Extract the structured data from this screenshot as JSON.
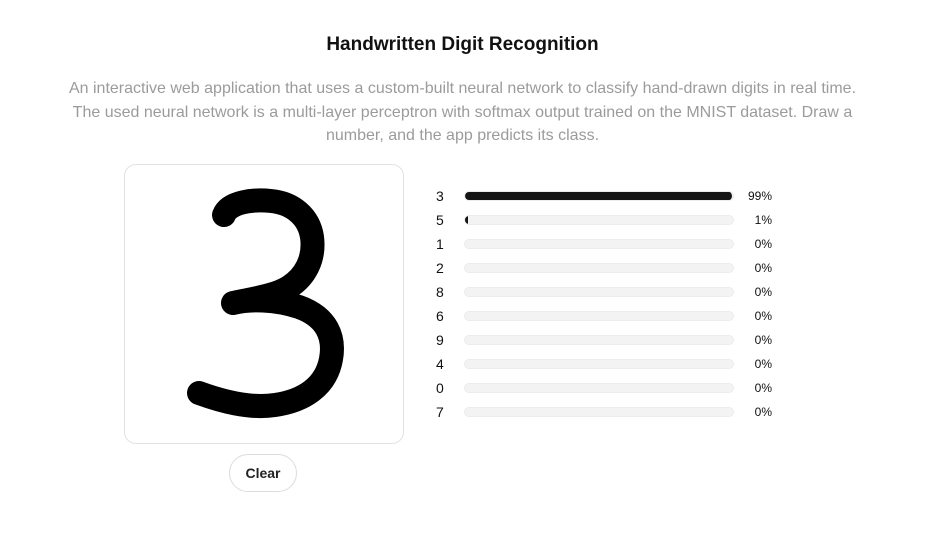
{
  "header": {
    "title": "Handwritten Digit Recognition",
    "description": "An interactive web application that uses a custom-built neural network to classify hand-drawn digits in real time. The used neural network is a multi-layer perceptron with softmax output trained on the MNIST dataset. Draw a number, and the app predicts its class."
  },
  "canvas": {
    "drawn_digit": "3",
    "clear_label": "Clear"
  },
  "predictions": [
    {
      "digit": "3",
      "percent": "99%",
      "value": 0.99
    },
    {
      "digit": "5",
      "percent": "1%",
      "value": 0.01
    },
    {
      "digit": "1",
      "percent": "0%",
      "value": 0
    },
    {
      "digit": "2",
      "percent": "0%",
      "value": 0
    },
    {
      "digit": "8",
      "percent": "0%",
      "value": 0
    },
    {
      "digit": "6",
      "percent": "0%",
      "value": 0
    },
    {
      "digit": "9",
      "percent": "0%",
      "value": 0
    },
    {
      "digit": "4",
      "percent": "0%",
      "value": 0
    },
    {
      "digit": "0",
      "percent": "0%",
      "value": 0
    },
    {
      "digit": "7",
      "percent": "0%",
      "value": 0
    }
  ],
  "colors": {
    "bar_fill": "#151515",
    "bar_track": "#f3f3f3",
    "description_text": "#9b9b9b"
  }
}
